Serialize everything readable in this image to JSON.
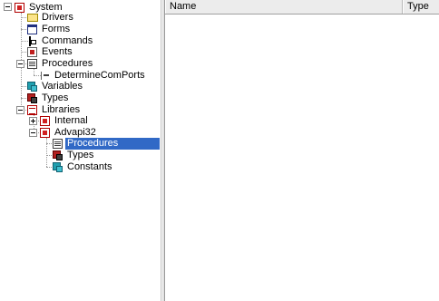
{
  "tree": {
    "system": "System",
    "drivers": "Drivers",
    "forms": "Forms",
    "commands": "Commands",
    "events": "Events",
    "procedures": "Procedures",
    "determine_com_ports": "DetermineComPorts",
    "variables": "Variables",
    "types": "Types",
    "libraries": "Libraries",
    "internal": "Internal",
    "advapi32": "Advapi32",
    "advapi32_procedures": "Procedures",
    "advapi32_types": "Types",
    "advapi32_constants": "Constants"
  },
  "list": {
    "columns": [
      "Name",
      "Type"
    ],
    "rows": []
  }
}
